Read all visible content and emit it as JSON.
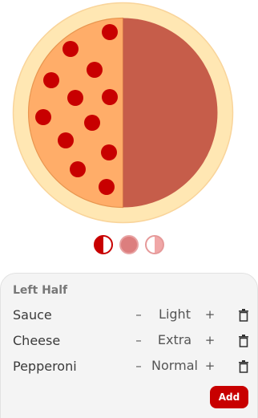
{
  "colors": {
    "crust": "#FFE7B3",
    "crust_edge": "#F9D49A",
    "left_cheese": "#FFAD69",
    "left_cheese_edge": "#E8954F",
    "right_sauce": "#C65D4A",
    "pepperoni": "#C80000",
    "accent": "#C80000"
  },
  "pizza": {
    "left_half_toppings": [
      "Sauce",
      "Cheese",
      "Pepperoni"
    ],
    "right_half_toppings": [
      "Sauce"
    ]
  },
  "half_selector": {
    "options": [
      "left-half",
      "whole",
      "right-half"
    ],
    "selected": "left-half"
  },
  "panel": {
    "title": "Left Half",
    "toppings": [
      {
        "name": "Sauce",
        "minus": "–",
        "value": "Light",
        "plus": "+",
        "icon": "trash-icon"
      },
      {
        "name": "Cheese",
        "minus": "–",
        "value": "Extra",
        "plus": "+",
        "icon": "trash-icon"
      },
      {
        "name": "Pepperoni",
        "minus": "–",
        "value": "Normal",
        "plus": "+",
        "icon": "trash-icon"
      }
    ],
    "add_label": "Add"
  }
}
